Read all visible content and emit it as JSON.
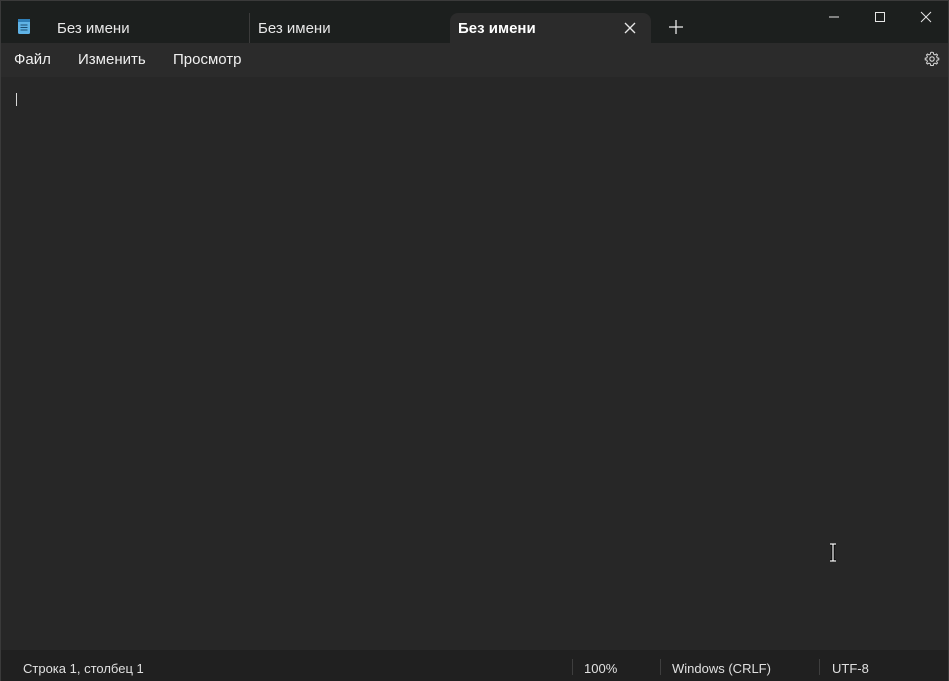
{
  "tabs": [
    {
      "label": "Без имени",
      "active": false
    },
    {
      "label": "Без имени",
      "active": false
    },
    {
      "label": "Без имени",
      "active": true
    }
  ],
  "window_controls": {
    "minimize_icon": "minimize-icon",
    "maximize_icon": "maximize-icon",
    "close_icon": "close-icon"
  },
  "menu": {
    "file": "Файл",
    "edit": "Изменить",
    "view": "Просмотр"
  },
  "editor": {
    "content": ""
  },
  "status": {
    "position": "Строка 1, столбец 1",
    "zoom": "100%",
    "line_ending": "Windows (CRLF)",
    "encoding": "UTF-8"
  },
  "colors": {
    "titlebar_bg": "#1c1f1e",
    "active_tab_bg": "#2b2b2b",
    "editor_bg": "#272727",
    "app_icon_accent": "#5fb3e6"
  }
}
